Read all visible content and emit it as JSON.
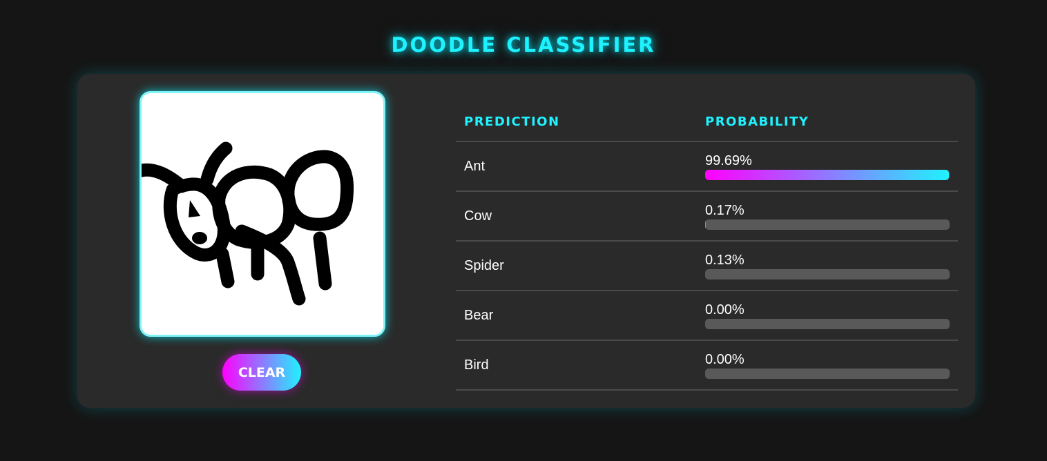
{
  "app": {
    "title": "DOODLE CLASSIFIER"
  },
  "canvas": {
    "clear_label": "CLEAR"
  },
  "table": {
    "headers": {
      "prediction": "PREDICTION",
      "probability": "PROBABILITY"
    },
    "rows": [
      {
        "label": "Ant",
        "probability_text": "99.69%",
        "probability": 0.9969
      },
      {
        "label": "Cow",
        "probability_text": "0.17%",
        "probability": 0.0017
      },
      {
        "label": "Spider",
        "probability_text": "0.13%",
        "probability": 0.0013
      },
      {
        "label": "Bear",
        "probability_text": "0.00%",
        "probability": 0.0
      },
      {
        "label": "Bird",
        "probability_text": "0.00%",
        "probability": 0.0
      }
    ]
  },
  "colors": {
    "accent": "#1ff2ff",
    "gradient_start": "#ff00ff",
    "gradient_end": "#1ff2ff",
    "panel": "#2a2a2a",
    "background": "#151515"
  }
}
